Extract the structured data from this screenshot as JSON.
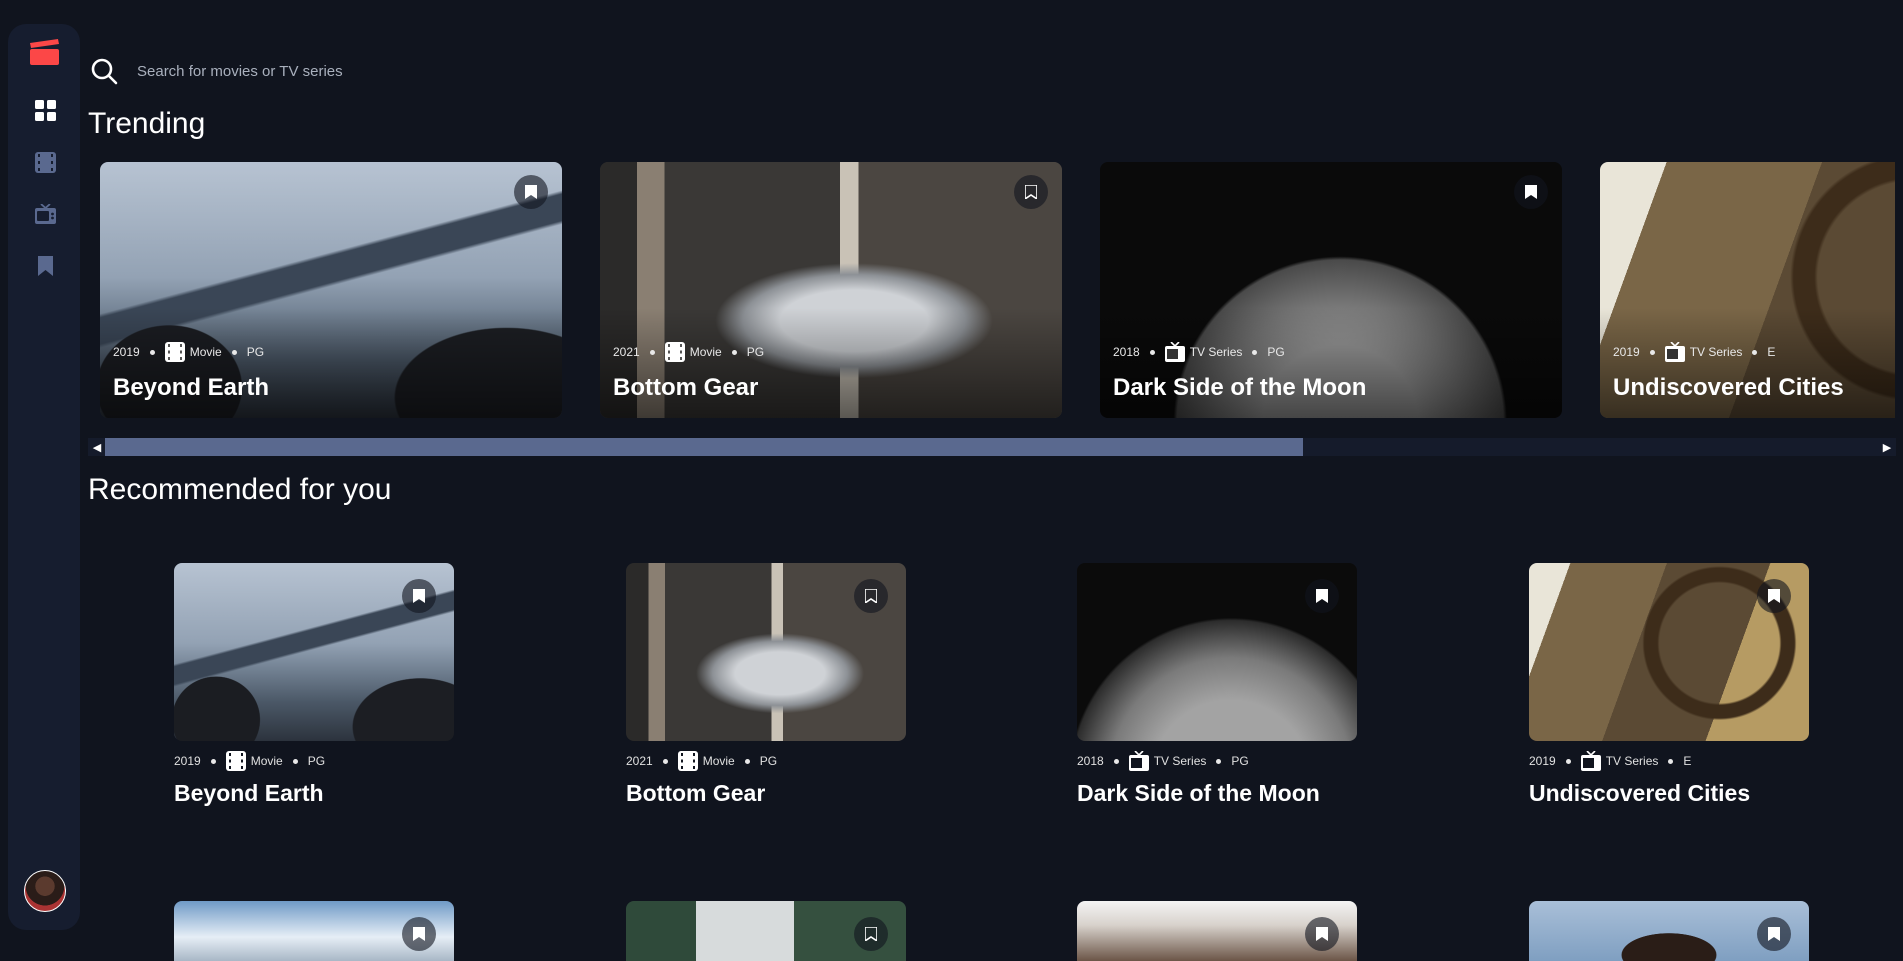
{
  "search": {
    "placeholder": "Search for movies or TV series"
  },
  "sections": {
    "trending": "Trending",
    "recommended": "Recommended for you"
  },
  "trending": [
    {
      "year": "2019",
      "category": "Movie",
      "rating": "PG",
      "title": "Beyond Earth"
    },
    {
      "year": "2021",
      "category": "Movie",
      "rating": "PG",
      "title": "Bottom Gear"
    },
    {
      "year": "2018",
      "category": "TV Series",
      "rating": "PG",
      "title": "Dark Side of the Moon"
    },
    {
      "year": "2019",
      "category": "TV Series",
      "rating": "E",
      "title": "Undiscovered Cities"
    }
  ],
  "recommended": [
    {
      "year": "2019",
      "category": "Movie",
      "rating": "PG",
      "title": "Beyond Earth"
    },
    {
      "year": "2021",
      "category": "Movie",
      "rating": "PG",
      "title": "Bottom Gear"
    },
    {
      "year": "2018",
      "category": "TV Series",
      "rating": "PG",
      "title": "Dark Side of the Moon"
    },
    {
      "year": "2019",
      "category": "TV Series",
      "rating": "E",
      "title": "Undiscovered Cities"
    }
  ],
  "trending_scroll": {
    "visible_fraction": 0.67,
    "position": 0
  },
  "icons": {
    "logo": "movie-clapperboard-icon",
    "nav": [
      "home-grid-icon",
      "movies-icon",
      "tv-series-icon",
      "bookmark-icon"
    ],
    "search": "search-icon",
    "card_bookmark": "bookmark-icon",
    "movie_category": "film-icon",
    "tv_category": "tv-icon"
  },
  "colors": {
    "background": "#10141e",
    "sidebar": "#161d2f",
    "accent": "#fc4747",
    "nav_inactive": "#5a698f",
    "scroll_thumb": "#5a698f"
  }
}
